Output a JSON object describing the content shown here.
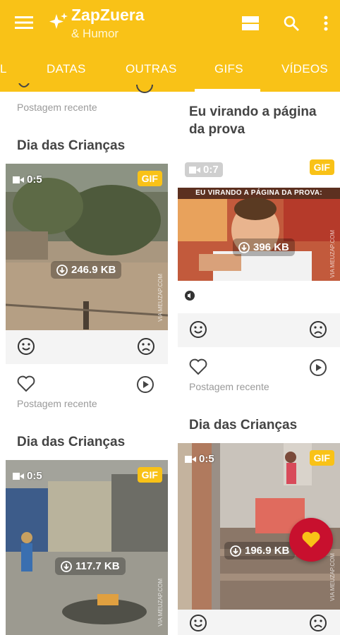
{
  "app": {
    "title": "ZapZuera",
    "subtitle": "& Humor",
    "accent_color": "#F9C217",
    "fab_color": "#C8102E"
  },
  "tabs": [
    {
      "label": "L",
      "active": false
    },
    {
      "label": "DATAS",
      "active": false
    },
    {
      "label": "OUTRAS",
      "active": false
    },
    {
      "label": "GIFS",
      "active": true
    },
    {
      "label": "VÍDEOS",
      "active": false
    }
  ],
  "left_column": {
    "top_partial_meta": "Postagem recente",
    "cards": [
      {
        "title": "Dia das Crianças",
        "badge": "GIF",
        "duration": "0:5",
        "size": "246.9 KB",
        "watermark": "VIA MEUZAP.COM",
        "meta": "Postagem recente"
      },
      {
        "title": "Dia das Crianças",
        "badge": "GIF",
        "duration": "0:5",
        "size": "117.7 KB",
        "watermark": "VIA MEUZAP.COM"
      }
    ]
  },
  "right_column": {
    "cards": [
      {
        "title": "Eu virando a página da prova",
        "badge": "GIF",
        "duration": "0:7",
        "size": "396 KB",
        "caption_in_image": "EU VIRANDO A PÁGINA DA PROVA:",
        "watermark": "VIA MEUZAP.COM",
        "meta": "Postagem recente"
      },
      {
        "title": "Dia das Crianças",
        "badge": "GIF",
        "duration": "0:5",
        "size": "196.9 KB",
        "watermark": "VIA MEUZAP.COM"
      }
    ]
  },
  "icons": {
    "menu": "hamburger-icon",
    "logo": "sparkle-icon",
    "layout": "view-toggle-icon",
    "search": "search-icon",
    "more": "more-vert-icon",
    "smile": "smile-icon",
    "sad": "sad-icon",
    "heart": "heart-outline-icon",
    "play": "play-circle-icon",
    "fab": "heart-filled-icon"
  }
}
